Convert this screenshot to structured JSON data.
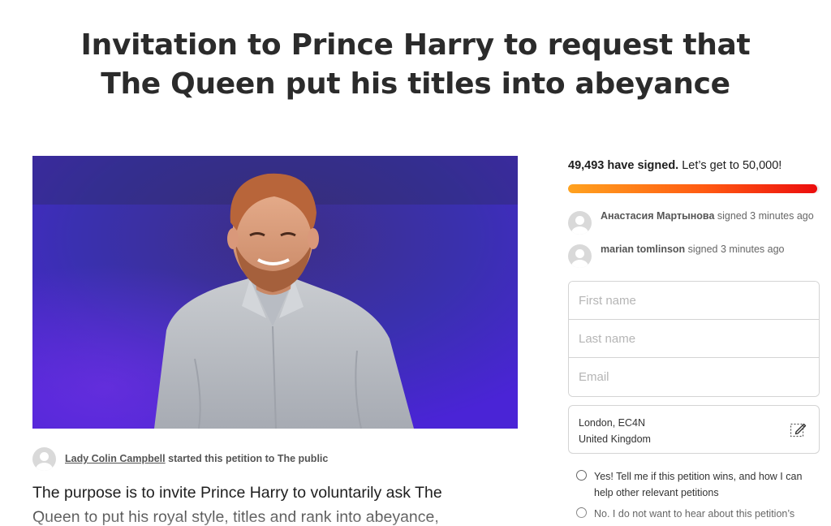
{
  "petition": {
    "title": "Invitation to Prince Harry to request that The Queen put his titles into abeyance",
    "image_alt": "Prince Harry smiling on stage in a light grey shirt against a blue-purple backdrop",
    "starter_name": "Lady Colin Campbell",
    "starter_suffix": " started this petition to The public",
    "description": "The purpose is to invite Prince Harry to voluntarily ask The Queen to put his royal style, titles and rank into abeyance,"
  },
  "signatures": {
    "count": "49,493 have signed.",
    "goal_text": " Let’s get to 50,000!",
    "progress_fraction": 0.99,
    "recent": [
      {
        "name": "Анастасия Мартынова",
        "action": " signed 3 minutes ago"
      },
      {
        "name": "marian tomlinson",
        "action": " signed 3 minutes ago"
      }
    ]
  },
  "form": {
    "first_name_placeholder": "First name",
    "last_name_placeholder": "Last name",
    "email_placeholder": "Email",
    "location_line1": "London, EC4N",
    "location_line2": "United Kingdom",
    "edit_icon": "pencil-edit-icon",
    "optin_yes": "Yes! Tell me if this petition wins, and how I can help other relevant petitions",
    "optin_no": "No. I do not want to hear about this petition’s"
  },
  "colors": {
    "progress_start": "#ffa21f",
    "progress_end": "#ec0d0d",
    "backdrop": "#3a2ea8"
  }
}
